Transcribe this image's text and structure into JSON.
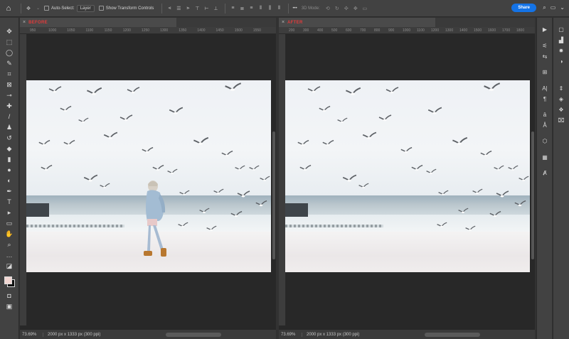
{
  "options_bar": {
    "auto_select_label": "Auto-Select:",
    "auto_select_value": "Layer",
    "show_transform_label": "Show Transform Controls",
    "more_label": "•••",
    "mode_3d_label": "3D Mode:",
    "share_label": "Share"
  },
  "documents": [
    {
      "tab_title": "BEFORE",
      "zoom": "73.69%",
      "dims": "2000 px x 1333 px (300 ppi)",
      "ruler_ticks": [
        "950",
        "1000",
        "1050",
        "1100",
        "1150",
        "1200",
        "1250",
        "1300",
        "1350",
        "1400",
        "1450",
        "1500",
        "1550"
      ]
    },
    {
      "tab_title": "AFTER",
      "zoom": "73.69%",
      "dims": "2000 px x 1333 px (300 ppi)",
      "ruler_ticks": [
        "200",
        "300",
        "400",
        "500",
        "600",
        "700",
        "800",
        "900",
        "1000",
        "1100",
        "1200",
        "1300",
        "1400",
        "1500",
        "1600",
        "1700",
        "1800"
      ]
    }
  ],
  "colors": {
    "foreground": "#f2d6d2",
    "background": "#111111",
    "accent": "#1473e6",
    "tab_title": "#e03b3b"
  },
  "tools": [
    "move-tool-icon",
    "marquee-tool-icon",
    "lasso-tool-icon",
    "quick-select-tool-icon",
    "crop-tool-icon",
    "frame-tool-icon",
    "eyedropper-tool-icon",
    "healing-brush-icon",
    "brush-tool-icon",
    "clone-stamp-icon",
    "history-brush-icon",
    "eraser-tool-icon",
    "gradient-tool-icon",
    "blur-tool-icon",
    "dodge-tool-icon",
    "pen-tool-icon",
    "type-tool-icon",
    "path-select-icon",
    "rectangle-tool-icon",
    "hand-tool-icon",
    "zoom-tool-icon",
    "more-tools-icon"
  ]
}
